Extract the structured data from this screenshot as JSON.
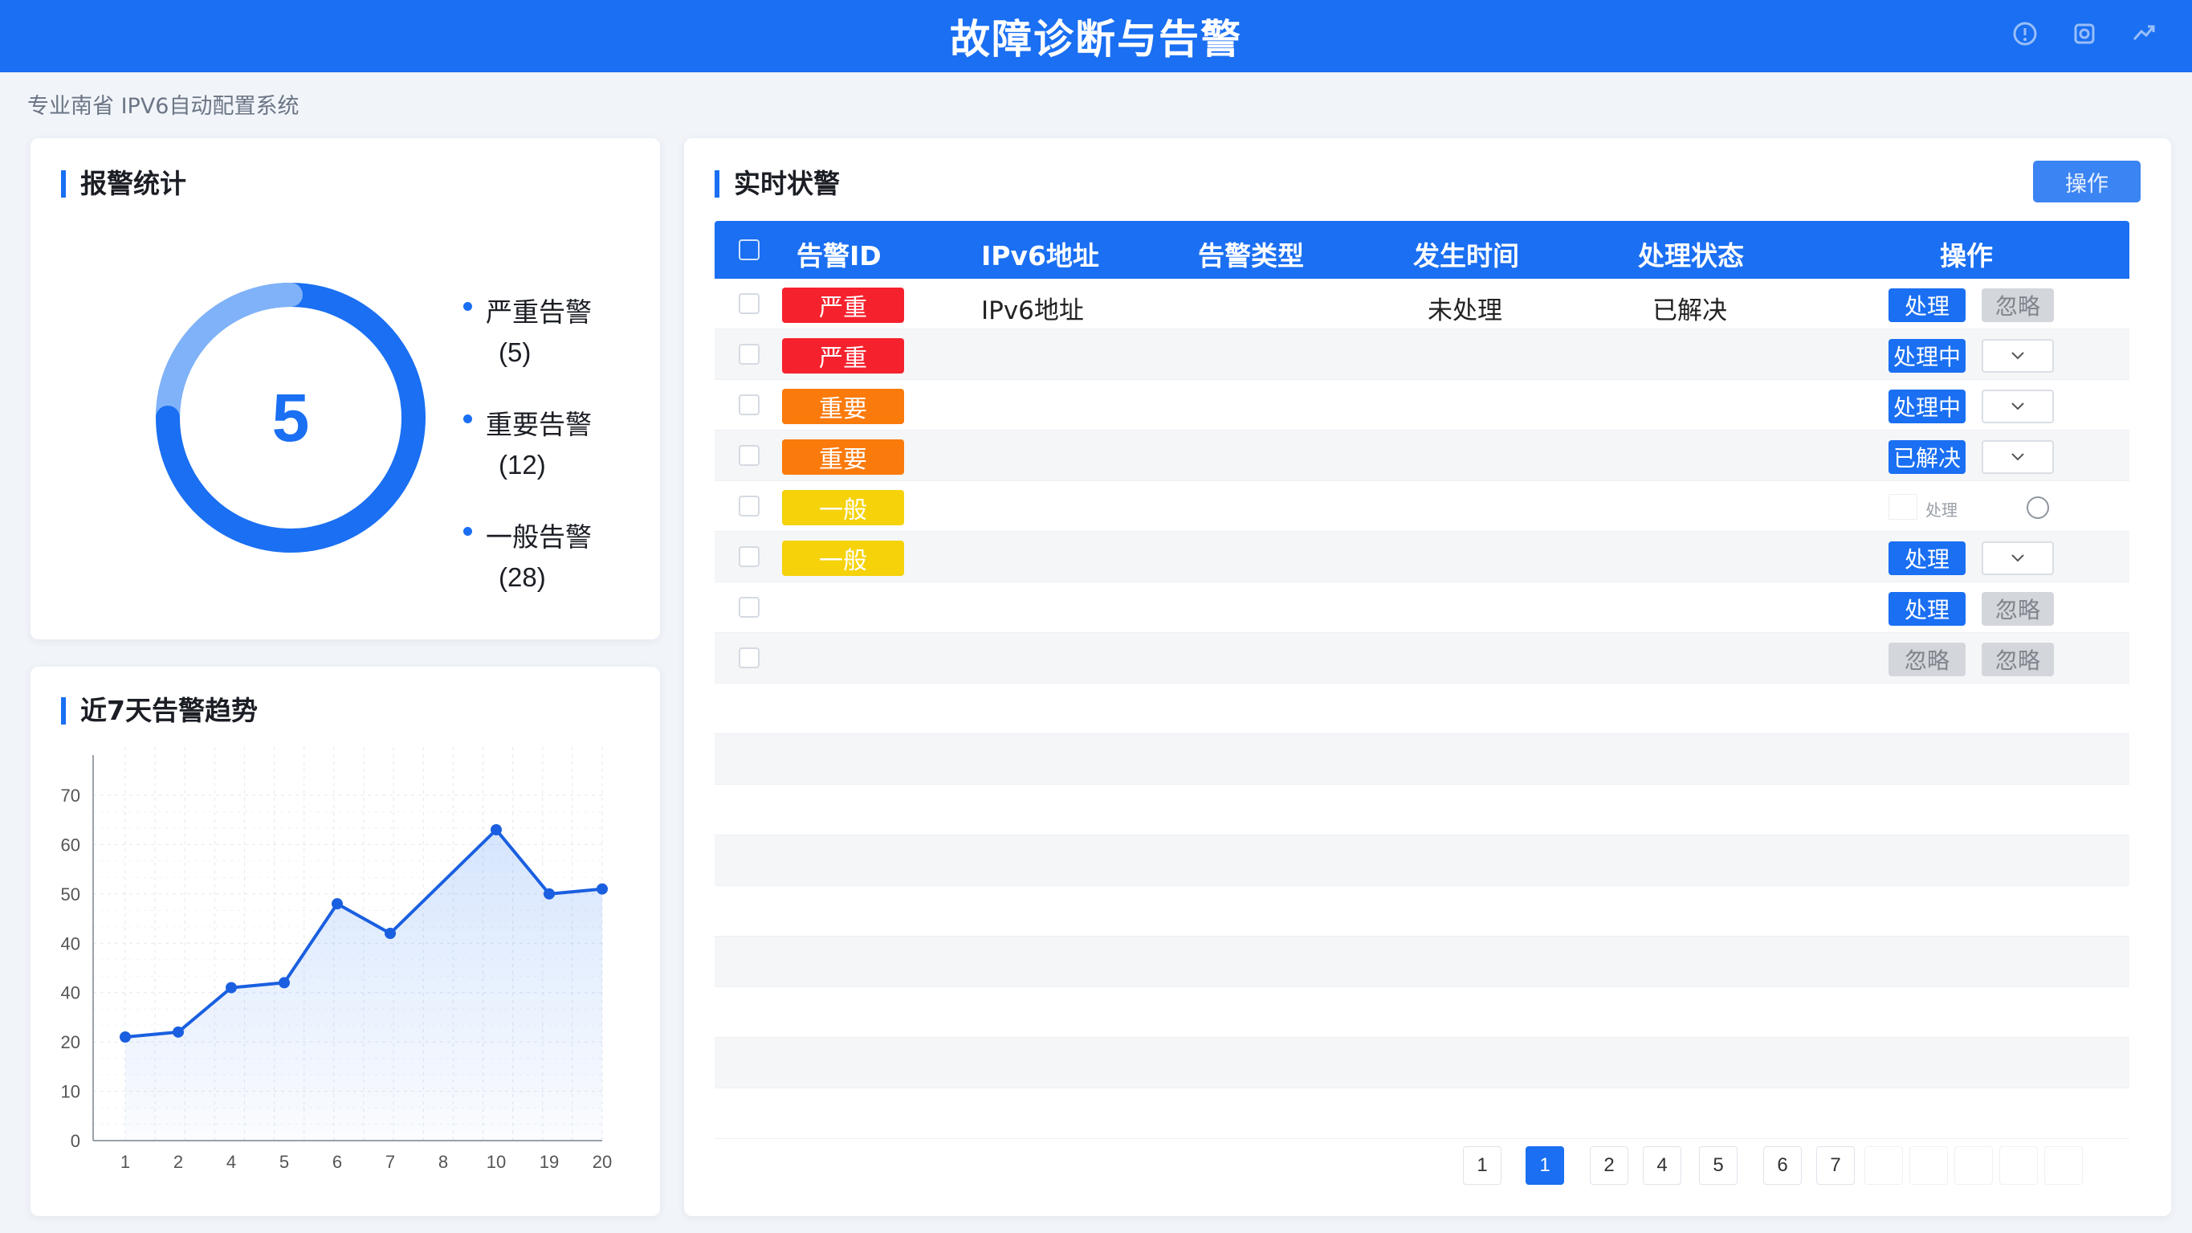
{
  "header": {
    "title": "故障诊断与告警",
    "icons": [
      "info-icon",
      "settings-icon",
      "share-icon"
    ]
  },
  "subtitle": "专业南省 IPV6自动配置系统",
  "stats": {
    "title": "报警统计",
    "total": "5",
    "legend": [
      {
        "label": "严重告警",
        "count": "(5)"
      },
      {
        "label": "重要告警",
        "count": "(12)"
      },
      {
        "label": "一般告警",
        "count": "(28)"
      }
    ],
    "colors": {
      "primary": "#1a6ff2",
      "light": "#7fb2f8"
    }
  },
  "trend": {
    "title": "近7天告警趋势"
  },
  "chart_data": {
    "type": "line",
    "title": "近7天告警趋势",
    "xlabel": "",
    "ylabel": "",
    "categories": [
      "1",
      "2",
      "4",
      "5",
      "6",
      "7",
      "8",
      "10",
      "19",
      "20"
    ],
    "y_tick_labels": [
      "0",
      "10",
      "20",
      "40",
      "40",
      "50",
      "60",
      "70"
    ],
    "series": [
      {
        "points": [
          {
            "x": "1",
            "y": 21
          },
          {
            "x": "2",
            "y": 22
          },
          {
            "x": "4",
            "y": 31
          },
          {
            "x": "5",
            "y": 32
          },
          {
            "x": "6",
            "y": 48
          },
          {
            "x": "7",
            "y": 42
          },
          {
            "x": "10",
            "y": 63
          },
          {
            "x": "19",
            "y": 50
          },
          {
            "x": "20",
            "y": 51
          }
        ]
      }
    ],
    "grid": true,
    "area_fill": true
  },
  "alerts": {
    "title": "实时状警",
    "op_button": "操作",
    "columns": [
      "告警ID",
      "IPv6地址",
      "告警类型",
      "发生时间",
      "处理状态",
      "操作"
    ],
    "rows": [
      {
        "level": "严重",
        "level_color": "#f5222d",
        "ipv6": "IPv6地址",
        "time": "未处理",
        "status": "已解决",
        "primary": "处理",
        "secondary": "忽略",
        "secondary_type": "gray"
      },
      {
        "level": "严重",
        "level_color": "#f5222d",
        "primary": "处理中",
        "secondary_type": "dropdown"
      },
      {
        "level": "重要",
        "level_color": "#fa7a0c",
        "primary": "处理中",
        "secondary_type": "dropdown"
      },
      {
        "level": "重要",
        "level_color": "#fa7a0c",
        "primary": "已解决",
        "secondary_type": "dropdown"
      },
      {
        "level": "一般",
        "level_color": "#f5d20a",
        "mini_label": "处理",
        "secondary_type": "radio"
      },
      {
        "level": "一般",
        "level_color": "#f5d20a",
        "primary": "处理",
        "secondary_type": "dropdown"
      },
      {
        "primary": "处理",
        "secondary": "忽略",
        "secondary_type": "gray"
      },
      {
        "primary_gray": "忽略",
        "secondary": "忽略",
        "secondary_type": "gray"
      }
    ],
    "empty_rows": 9,
    "pagination": [
      "1",
      "1",
      "2",
      "4",
      "5",
      "6",
      "7"
    ],
    "active_page_index": 1
  }
}
